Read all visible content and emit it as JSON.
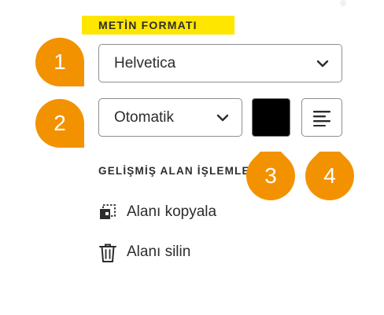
{
  "text_format": {
    "title": "METİN FORMATI",
    "font_family": "Helvetica",
    "font_size": "Otomatik",
    "text_color": "#000000"
  },
  "advanced": {
    "title": "GELİŞMİŞ ALAN İŞLEMLERİ",
    "copy_label": "Alanı kopyala",
    "delete_label": "Alanı silin"
  },
  "markers": [
    "1",
    "2",
    "3",
    "4"
  ],
  "colors": {
    "highlight": "#ffe600",
    "marker": "#f39200",
    "text": "#2c2c2c"
  }
}
